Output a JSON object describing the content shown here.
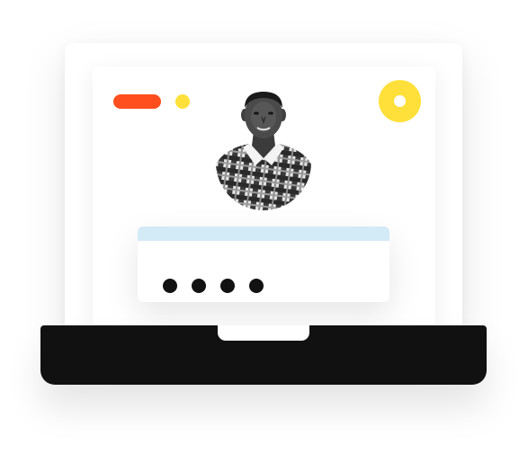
{
  "login_card": {
    "password_mask_count": 4
  },
  "icons": {
    "status_pill": "orange-pill-icon",
    "status_dot": "yellow-dot-icon",
    "ring": "yellow-ring-icon",
    "avatar": "user-avatar"
  },
  "colors": {
    "accent_orange": "#ff4f1f",
    "accent_yellow": "#ffe03a",
    "card_header": "#d3eaf7",
    "laptop_base": "#111111",
    "mask_dot": "#121212"
  }
}
